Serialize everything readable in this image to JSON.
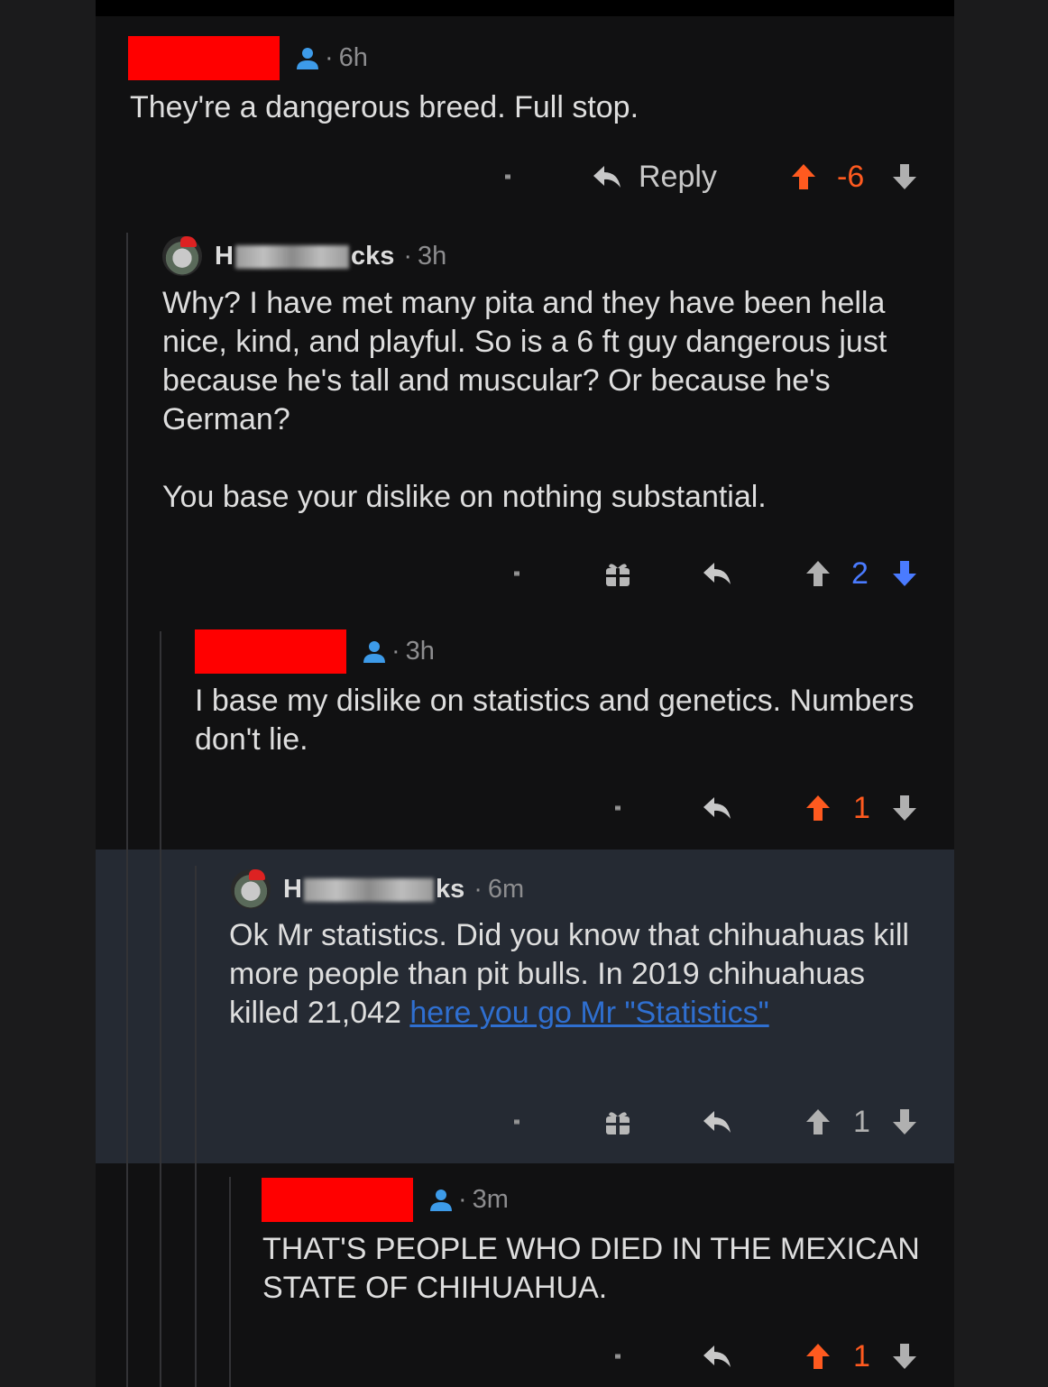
{
  "comments": [
    {
      "time": "6h",
      "text": "They're a dangerous breed. Full stop.",
      "reply_label": "Reply",
      "score": "-6",
      "vote_state": "upvoted",
      "redacted_user": true
    },
    {
      "user_prefix": "H",
      "user_suffix": "cks",
      "time": "3h",
      "text": "Why? I have met many pita and they have been hella nice, kind, and playful. So is a 6 ft guy dangerous just because he's tall and muscular? Or because he's German?\n\nYou base your dislike on nothing substantial.",
      "score": "2",
      "vote_state": "downvoted"
    },
    {
      "time": "3h",
      "text": "I base my dislike on statistics and genetics. Numbers don't lie.",
      "score": "1",
      "vote_state": "upvoted",
      "redacted_user": true
    },
    {
      "user_prefix": "H",
      "user_suffix": "ks",
      "time": "6m",
      "text": "Ok Mr statistics. Did you know that chihuahuas kill more people than pit bulls. In 2019 chihuahuas killed 21,042 ",
      "link_text": "here you go Mr \"Statistics\"",
      "score": "1",
      "vote_state": "none",
      "highlighted": true
    },
    {
      "time": "3m",
      "text": "THAT'S PEOPLE WHO DIED IN THE MEXICAN STATE OF CHIHUAHUA.",
      "score": "1",
      "vote_state": "upvoted",
      "redacted_user": true
    }
  ],
  "colors": {
    "background": "#111112",
    "upvote": "#ff5a1f",
    "downvote": "#4a7bff",
    "neutral": "#b0b0b0",
    "highlight": "#252a33",
    "redaction": "#ff0000",
    "user_icon": "#3d9be9",
    "link": "#2f6fd0"
  }
}
